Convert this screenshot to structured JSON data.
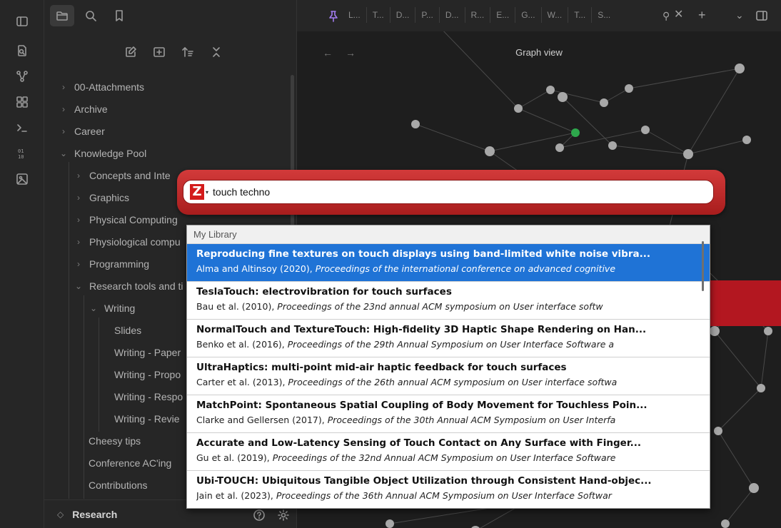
{
  "ribbon": {
    "icons": [
      "open-quick-switcher-icon",
      "graph-icon",
      "canvas-icon",
      "terminal-icon",
      "binary-icon",
      "image-icon"
    ]
  },
  "sidebar": {
    "tree": [
      {
        "label": "00-Attachments",
        "depth": 0,
        "chevron": "›"
      },
      {
        "label": "Archive",
        "depth": 0,
        "chevron": "›"
      },
      {
        "label": "Career",
        "depth": 0,
        "chevron": "›"
      },
      {
        "label": "Knowledge Pool",
        "depth": 0,
        "chevron": "⌄"
      },
      {
        "label": "Concepts and Inte",
        "depth": 1,
        "chevron": "›"
      },
      {
        "label": "Graphics",
        "depth": 1,
        "chevron": "›"
      },
      {
        "label": "Physical Computing",
        "depth": 1,
        "chevron": "›"
      },
      {
        "label": "Physiological compu",
        "depth": 1,
        "chevron": "›"
      },
      {
        "label": "Programming",
        "depth": 1,
        "chevron": "›"
      },
      {
        "label": "Research tools and ti",
        "depth": 1,
        "chevron": "⌄"
      },
      {
        "label": "Writing",
        "depth": 2,
        "chevron": "⌄"
      },
      {
        "label": "Slides",
        "depth": 3,
        "chevron": ""
      },
      {
        "label": "Writing - Paper",
        "depth": 3,
        "chevron": ""
      },
      {
        "label": "Writing - Propo",
        "depth": 3,
        "chevron": ""
      },
      {
        "label": "Writing - Respo",
        "depth": 3,
        "chevron": ""
      },
      {
        "label": "Writing - Revie",
        "depth": 3,
        "chevron": ""
      },
      {
        "label": "Cheesy tips",
        "depth": 2,
        "chevron": ""
      },
      {
        "label": "Conference AC'ing",
        "depth": 2,
        "chevron": ""
      },
      {
        "label": "Contributions",
        "depth": 2,
        "chevron": ""
      }
    ],
    "vault_name": "Research"
  },
  "tabs": {
    "items": [
      "L...",
      "T...",
      "D...",
      "P...",
      "D...",
      "R...",
      "E...",
      "G...",
      "W...",
      "T...",
      "S..."
    ],
    "active_label": ""
  },
  "graph": {
    "title": "Graph view",
    "highlight_color": "#2ea84c"
  },
  "zotero": {
    "query": "touch techno",
    "group": "My Library",
    "results": [
      {
        "title": "Reproducing fine textures on touch displays using band-limited white noise vibra...",
        "authors": "Alma and Altinsoy (2020), ",
        "venue": "Proceedings of the international conference on advanced cognitive",
        "selected": true
      },
      {
        "title": "TeslaTouch: electrovibration for touch surfaces",
        "authors": "Bau et al. (2010), ",
        "venue": "Proceedings of the 23nd annual ACM symposium on User interface softw",
        "selected": false
      },
      {
        "title": "NormalTouch and TextureTouch: High-fidelity 3D Haptic Shape Rendering on Han...",
        "authors": "Benko et al. (2016), ",
        "venue": "Proceedings of the 29th Annual Symposium on User Interface Software a",
        "selected": false
      },
      {
        "title": "UltraHaptics: multi-point mid-air haptic feedback for touch surfaces",
        "authors": "Carter et al. (2013), ",
        "venue": "Proceedings of the 26th annual ACM symposium on User interface softwa",
        "selected": false
      },
      {
        "title": "MatchPoint: Spontaneous Spatial Coupling of Body Movement for Touchless Poin...",
        "authors": "Clarke and Gellersen (2017), ",
        "venue": "Proceedings of the 30th Annual ACM Symposium on User Interfa",
        "selected": false
      },
      {
        "title": "Accurate and Low-Latency Sensing of Touch Contact on Any Surface with Finger...",
        "authors": "Gu et al. (2019), ",
        "venue": "Proceedings of the 32nd Annual ACM Symposium on User Interface Software",
        "selected": false
      },
      {
        "title": "Ubi-TOUCH: Ubiquitous Tangible Object Utilization through Consistent Hand-objec...",
        "authors": "Jain et al. (2023), ",
        "venue": "Proceedings of the 36th Annual ACM Symposium on User Interface Softwar",
        "selected": false
      }
    ]
  }
}
